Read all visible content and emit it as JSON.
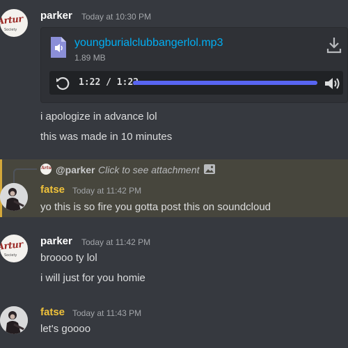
{
  "messages": [
    {
      "author": "parker",
      "timestamp": "Today at 10:30 PM",
      "attachment": {
        "file_name": "youngburialclubbangerlol.mp3",
        "file_size": "1.89 MB",
        "time_display": "1:22 / 1:22",
        "progress": 1.0
      },
      "lines": [
        "i apologize in advance lol",
        "this was made in 10 minutes"
      ]
    },
    {
      "reply": {
        "user": "@parker",
        "text": "Click to see attachment"
      },
      "author": "fatse",
      "timestamp": "Today at 11:42 PM",
      "lines": [
        "yo this is so fire you gotta post this on soundcloud"
      ]
    },
    {
      "author": "parker",
      "timestamp": "Today at 11:42 PM",
      "lines": [
        "broooo ty lol",
        "i will just for you homie"
      ]
    },
    {
      "author": "fatse",
      "timestamp": "Today at 11:43 PM",
      "lines": [
        "let's goooo"
      ]
    }
  ],
  "avatar_text": {
    "logo": "Artur",
    "sub": "Society"
  },
  "colors": {
    "background": "#36393f",
    "mention_highlight": "#47463d",
    "link": "#00aff4",
    "progress_fill": "#5865f2",
    "fatse_name": "#f0c23a"
  },
  "icons": {
    "file": "audio-file-icon",
    "download": "download-icon",
    "replay": "replay-icon",
    "volume": "volume-icon",
    "image": "image-icon"
  }
}
